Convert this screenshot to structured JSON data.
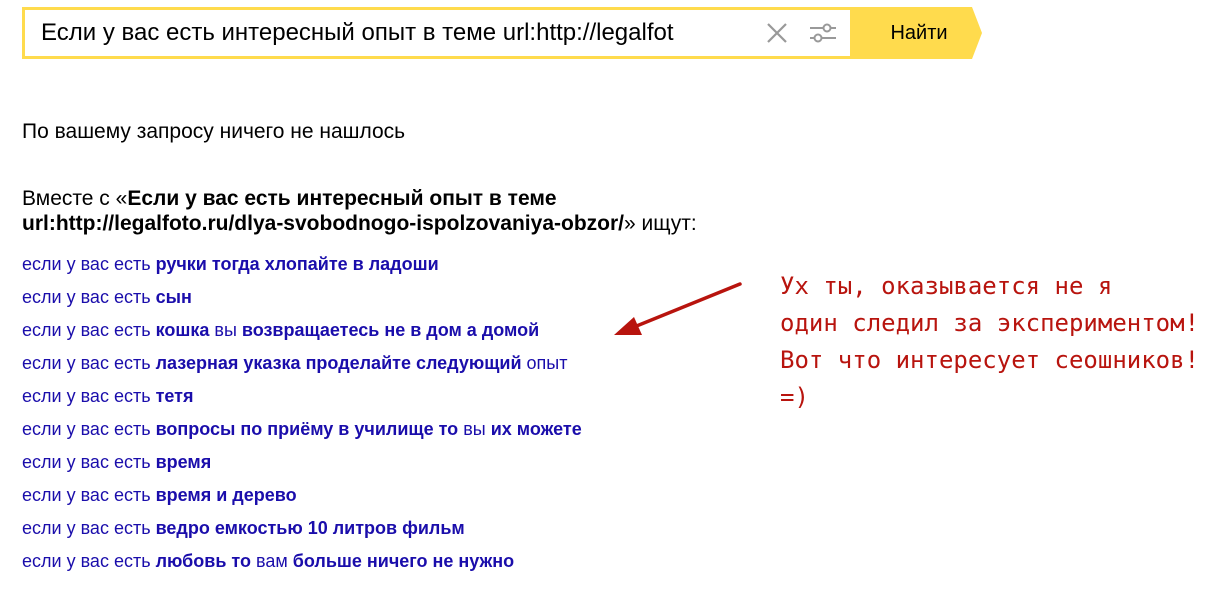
{
  "search": {
    "query": "Если у вас есть интересный опыт в теме url:http://legalfot",
    "button_label": "Найти"
  },
  "results": {
    "no_results_text": "По вашему запросу ничего не нашлось",
    "related_prefix": "Вместе с «",
    "related_query": "Если у вас есть интересный опыт в теме url:http://legalfoto.ru/dlya-svobodnogo-ispolzovaniya-obzor/",
    "related_suffix": "» ищут:",
    "suggestions": [
      [
        {
          "t": "если у вас есть ",
          "b": false
        },
        {
          "t": "ручки тогда хлопайте в ладоши",
          "b": true
        }
      ],
      [
        {
          "t": "если у вас есть ",
          "b": false
        },
        {
          "t": "сын",
          "b": true
        }
      ],
      [
        {
          "t": "если у вас есть ",
          "b": false
        },
        {
          "t": "кошка",
          "b": true
        },
        {
          "t": " вы ",
          "b": false
        },
        {
          "t": "возвращаетесь не в дом а домой",
          "b": true
        }
      ],
      [
        {
          "t": "если у вас есть ",
          "b": false
        },
        {
          "t": "лазерная указка проделайте следующий",
          "b": true
        },
        {
          "t": " опыт",
          "b": false
        }
      ],
      [
        {
          "t": "если у вас есть ",
          "b": false
        },
        {
          "t": "тетя",
          "b": true
        }
      ],
      [
        {
          "t": "если у вас есть ",
          "b": false
        },
        {
          "t": "вопросы по приёму в училище то",
          "b": true
        },
        {
          "t": " вы ",
          "b": false
        },
        {
          "t": "их можете",
          "b": true
        }
      ],
      [
        {
          "t": "если у вас есть ",
          "b": false
        },
        {
          "t": "время",
          "b": true
        }
      ],
      [
        {
          "t": "если у вас есть ",
          "b": false
        },
        {
          "t": "время и дерево",
          "b": true
        }
      ],
      [
        {
          "t": "если у вас есть ",
          "b": false
        },
        {
          "t": "ведро емкостью 10 литров фильм",
          "b": true
        }
      ],
      [
        {
          "t": "если у вас есть ",
          "b": false
        },
        {
          "t": "любовь то",
          "b": true
        },
        {
          "t": " вам ",
          "b": false
        },
        {
          "t": "больше ничего не нужно",
          "b": true
        }
      ]
    ]
  },
  "annotation": {
    "lines": [
      "Ух ты, оказывается не я",
      "один следил за экспериментом!",
      "Вот что интересует сеошников!",
      "=)"
    ]
  },
  "colors": {
    "accent": "#ffdb4d",
    "link": "#1a0dab",
    "annotation": "#b8140e"
  },
  "icons": {
    "clear": "close-icon",
    "settings": "sliders-icon"
  }
}
